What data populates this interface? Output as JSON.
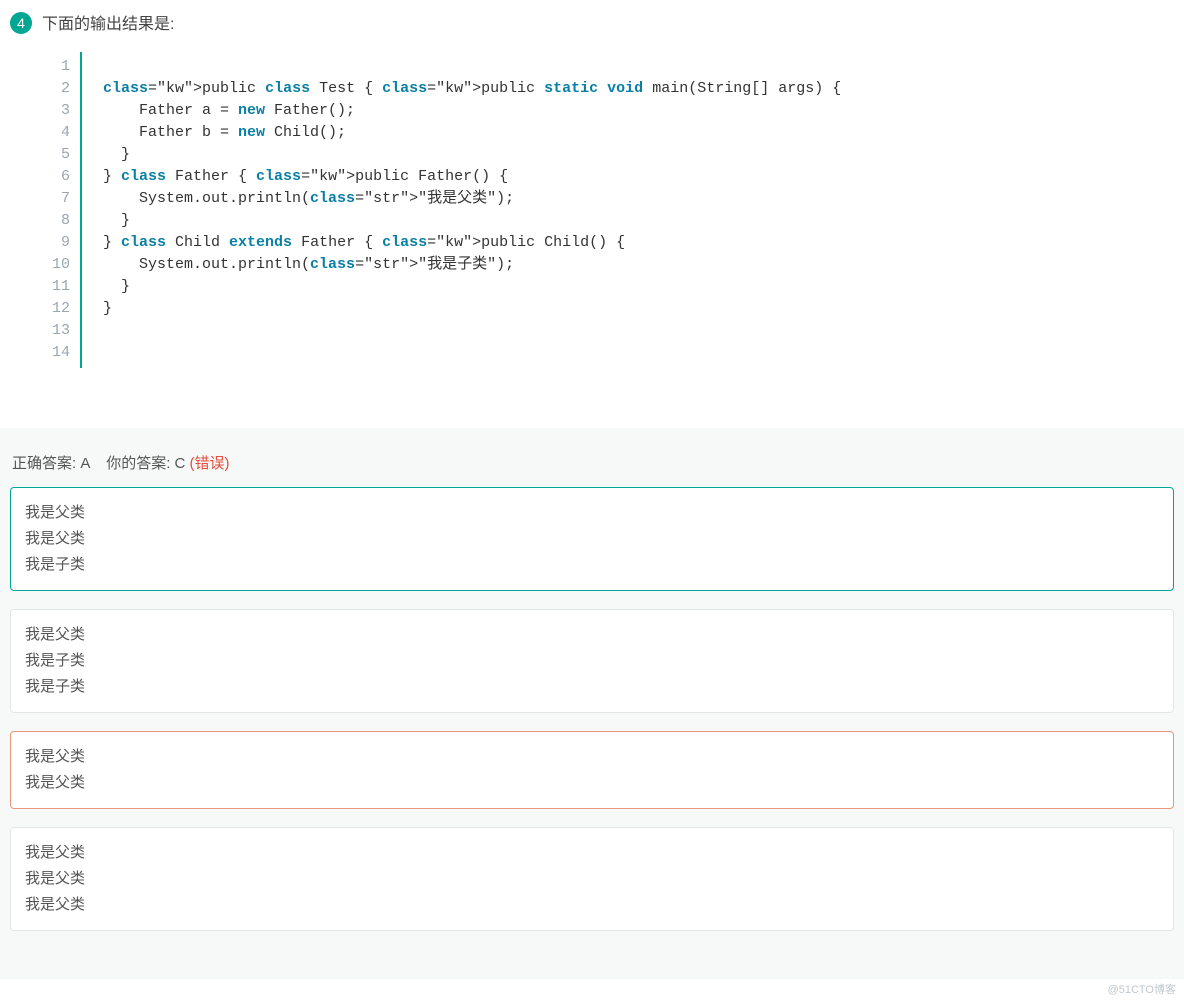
{
  "question": {
    "number": "4",
    "title": "下面的输出结果是:"
  },
  "code": {
    "line_count": 14,
    "lines": [
      "",
      " public class Test { public static void main(String[] args) {",
      "     Father a = new Father();",
      "     Father b = new Child();",
      "   }",
      " } class Father { public Father() {",
      "     System.out.println(\"我是父类\");",
      "   }",
      " } class Child extends Father { public Child() {",
      "     System.out.println(\"我是子类\");",
      "   }",
      " }",
      "",
      ""
    ]
  },
  "answer": {
    "correct_label": "正确答案: A",
    "your_label": "你的答案: C",
    "wrong_tag": "(错误)"
  },
  "options": [
    {
      "id": "A",
      "lines": [
        "我是父类",
        "我是父类",
        "我是子类"
      ],
      "state": "correct"
    },
    {
      "id": "B",
      "lines": [
        "我是父类",
        "我是子类",
        "我是子类"
      ],
      "state": "normal"
    },
    {
      "id": "C",
      "lines": [
        "我是父类",
        "我是父类"
      ],
      "state": "selected-wrong"
    },
    {
      "id": "D",
      "lines": [
        "我是父类",
        "我是父类",
        "我是父类"
      ],
      "state": "normal"
    }
  ],
  "watermark": "@51CTO博客"
}
